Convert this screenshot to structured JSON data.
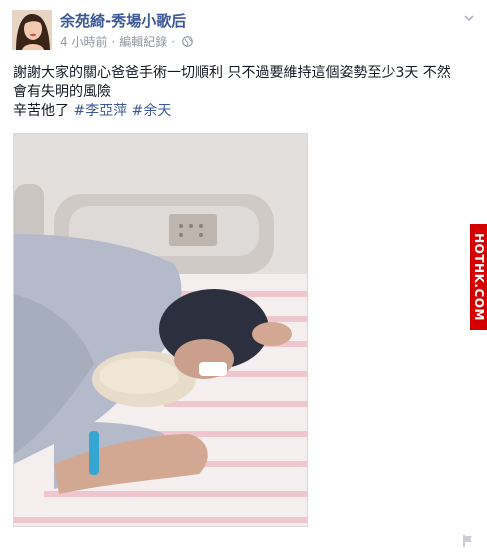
{
  "post": {
    "author_name": "余苑綺-秀場小歌后",
    "time": "4 小時前",
    "separator": "·",
    "edit_history": "編輯紀錄",
    "text_line1": "謝謝大家的關心爸爸手術一切順利 只不過要維持這個姿勢至少3天 不然",
    "text_line2": "會有失明的風險",
    "text_line3": "辛苦他了 ",
    "hashtag1": "#李亞萍",
    "hashtag2": "#余天",
    "icons": {
      "globe": "globe-icon",
      "chevron": "chevron-down-icon",
      "flag": "flag-icon"
    }
  },
  "watermark": {
    "text": "HOTHK.COM"
  },
  "colors": {
    "link": "#3b5998",
    "text": "#141823",
    "meta": "#9197a3",
    "watermark_bg": "#d40000"
  }
}
